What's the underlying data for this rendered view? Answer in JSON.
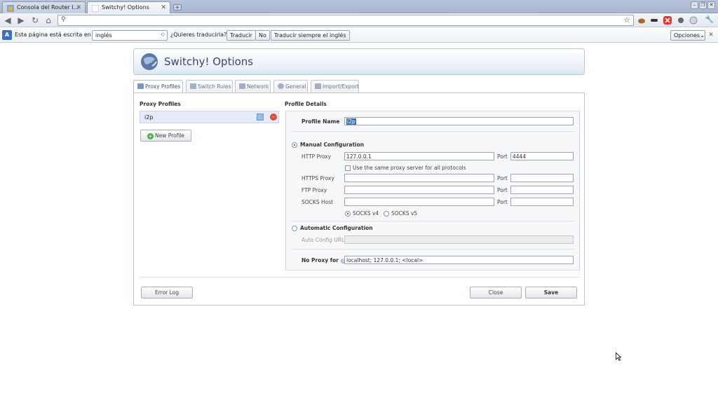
{
  "browser": {
    "tabs": [
      {
        "label": "Consola del Router I…"
      },
      {
        "label": "Switchy! Options"
      }
    ],
    "address": ""
  },
  "infobar": {
    "lead": "Esta página está escrita en",
    "language": "inglés",
    "question": "¿Quieres traducirla?",
    "translate": "Traducir",
    "no": "No",
    "always": "Traducir siempre el inglés",
    "options": "Opciones"
  },
  "page": {
    "title": "Switchy! Options",
    "tabs": [
      "Proxy Profiles",
      "Switch Rules",
      "Network",
      "General",
      "Import/Export"
    ],
    "left": {
      "heading": "Proxy Profiles",
      "profiles": [
        {
          "name": "i2p"
        }
      ],
      "new_profile": "New Profile",
      "error_log": "Error Log"
    },
    "details": {
      "heading": "Profile Details",
      "profile_name_label": "Profile Name",
      "profile_name": "i2p",
      "manual": "Manual Configuration",
      "http_label": "HTTP Proxy",
      "http_value": "127.0.0.1",
      "port_label": "Port",
      "http_port": "4444",
      "same_proxy": "Use the same proxy server for all protocols",
      "https_label": "HTTPS Proxy",
      "ftp_label": "FTP Proxy",
      "socks_label": "SOCKS Host",
      "socks4": "SOCKS v4",
      "socks5": "SOCKS v5",
      "auto": "Automatic Configuration",
      "auto_url_label": "Auto Config URL",
      "no_proxy_label": "No Proxy for",
      "no_proxy_value": "localhost; 127.0.0.1; <local>"
    },
    "close": "Close",
    "save": "Save"
  }
}
